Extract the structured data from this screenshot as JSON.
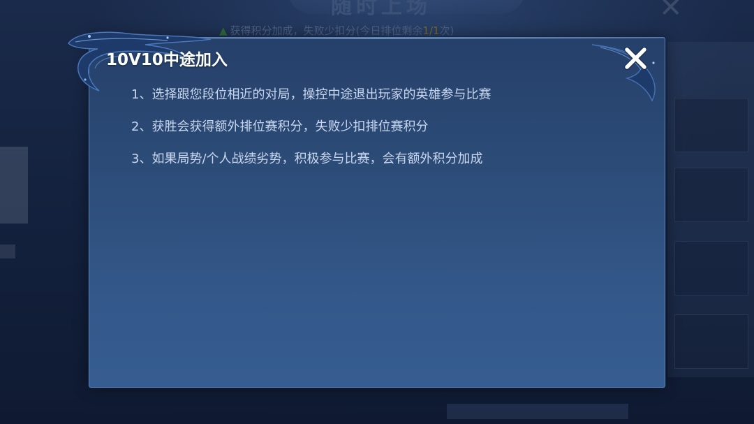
{
  "background": {
    "title": "随时上场",
    "hint_prefix": "获得积分加成，失败少扣分(今日排位剩余",
    "hint_count": "1/1",
    "hint_suffix": "次)"
  },
  "dialog": {
    "title": "10V10中途加入",
    "close_icon": "close-x-icon",
    "rules": [
      "1、选择跟您段位相近的对局，操控中途退出玩家的英雄参与比赛",
      "2、获胜会获得额外排位赛积分，失败少扣排位赛积分",
      "3、如果局势/个人战绩劣势，积极参与比赛，会有额外积分加成"
    ]
  },
  "colors": {
    "dialog_background": "#2c4b77",
    "dialog_border": "#5d83bb",
    "title_text": "#ffffff",
    "body_text": "#c9d7ee"
  }
}
